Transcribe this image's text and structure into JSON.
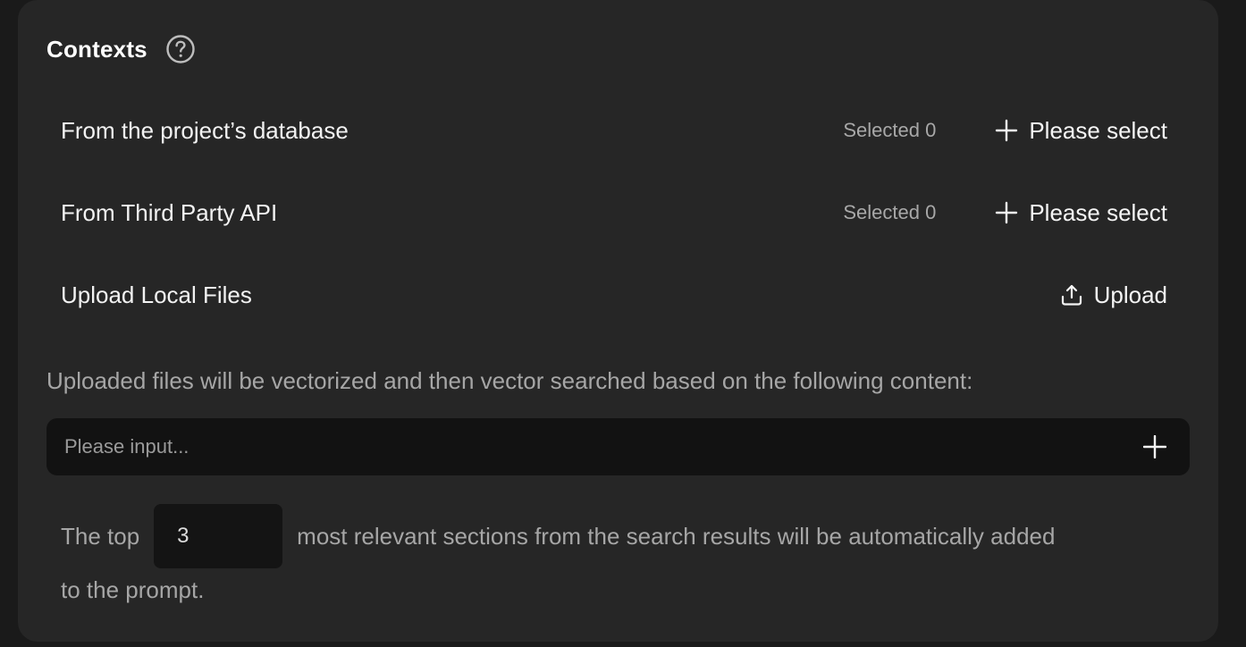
{
  "contexts": {
    "title": "Contexts",
    "help_icon": "question-circle-icon",
    "rows": [
      {
        "label": "From the project’s database",
        "count": "Selected 0",
        "action": "Please select",
        "action_icon": "plus-icon"
      },
      {
        "label": "From Third Party API",
        "count": "Selected 0",
        "action": "Please select",
        "action_icon": "plus-icon"
      },
      {
        "label": "Upload Local Files",
        "action": "Upload",
        "action_icon": "upload-icon"
      }
    ],
    "hint": "Uploaded files will be vectorized and then vector searched based on the following content:",
    "input": {
      "placeholder": "Please input...",
      "value": "",
      "add_icon": "plus-icon"
    },
    "topk": {
      "prefix": "The top",
      "value": "3",
      "suffix_line1": "most relevant sections from the search results will be automatically added",
      "suffix_line2": "to the prompt."
    }
  },
  "colors": {
    "page_bg": "#1a1a1a",
    "panel_bg": "#262626",
    "input_bg": "#121212",
    "text_primary": "#f2f2f2",
    "text_secondary": "#a6a6a6"
  }
}
